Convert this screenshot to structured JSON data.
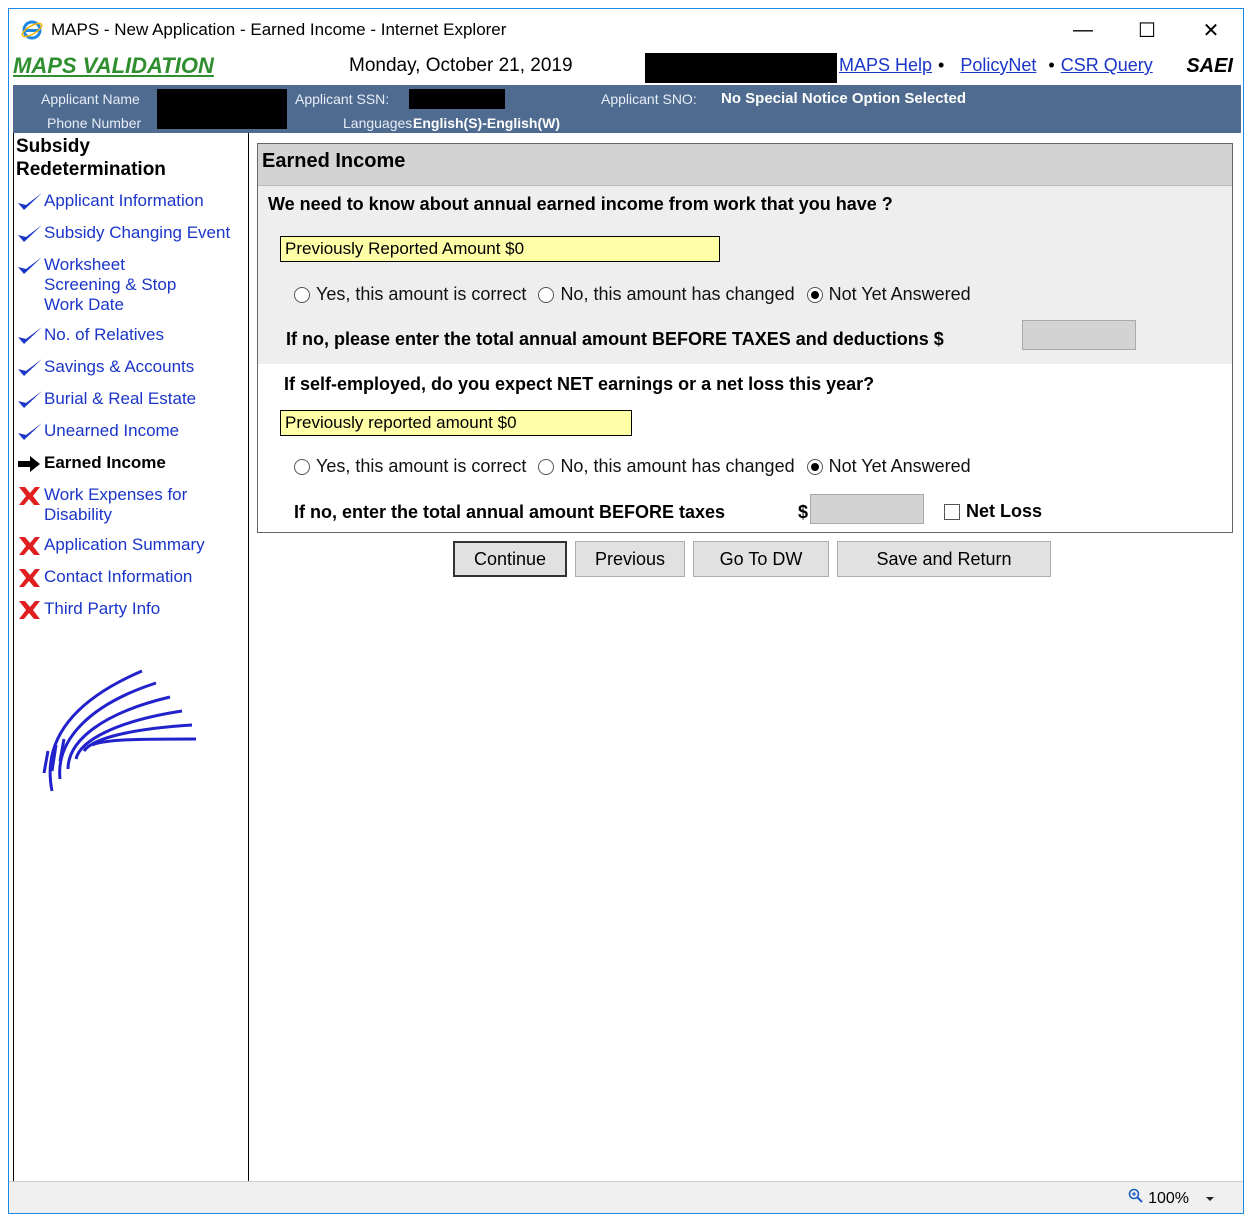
{
  "window": {
    "title": "MAPS - New Application - Earned Income - Internet Explorer",
    "minimize": "—",
    "maximize": "☐",
    "close": "✕"
  },
  "header": {
    "app_name": "MAPS VALIDATION",
    "date": "Monday, October 21, 2019",
    "links": [
      {
        "label": "MAPS Help"
      },
      {
        "label": "PolicyNet"
      },
      {
        "label": "CSR Query"
      }
    ],
    "separator": "•",
    "system_code": "SAEI"
  },
  "applicant": {
    "name_label": "Applicant Name",
    "phone_label": "Phone Number",
    "ssn_label": "Applicant SSN:",
    "languages_label": "Languages:",
    "languages_value": "English(S)-English(W)",
    "sno_label": "Applicant SNO:",
    "sno_value": "No Special Notice Option Selected"
  },
  "nav": {
    "title": "Subsidy Redetermination",
    "items": [
      {
        "label": "Applicant Information",
        "status": "check"
      },
      {
        "label": "Subsidy Changing Event",
        "status": "check"
      },
      {
        "label": "Worksheet Screening  & Stop Work  Date",
        "status": "check"
      },
      {
        "label": "No. of Relatives",
        "status": "check"
      },
      {
        "label": "Savings & Accounts",
        "status": "check"
      },
      {
        "label": "Burial & Real Estate",
        "status": "check"
      },
      {
        "label": "Unearned Income",
        "status": "check"
      },
      {
        "label": "Earned Income",
        "status": "current"
      },
      {
        "label": "Work Expenses for Disability",
        "status": "x"
      },
      {
        "label": "Application Summary",
        "status": "x"
      },
      {
        "label": "Contact Information",
        "status": "x"
      },
      {
        "label": "Third Party Info",
        "status": "x"
      }
    ]
  },
  "form": {
    "title": "Earned Income",
    "q1": {
      "question": "We need to know about annual earned income from work that you have ?",
      "previous": "Previously Reported Amount $0",
      "options": [
        "Yes, this amount is correct",
        "No, this amount has changed",
        "Not Yet Answered"
      ],
      "selected": 2,
      "amount_label": "If no, please enter the total annual amount BEFORE TAXES and deductions $",
      "amount_value": ""
    },
    "q2": {
      "question": "If self-employed, do you expect NET earnings or a net loss this year?",
      "previous": "Previously reported amount $0",
      "options": [
        "Yes, this amount is correct",
        "No, this amount has changed",
        "Not Yet Answered"
      ],
      "selected": 2,
      "amount_label": "If no, enter the total annual amount BEFORE taxes",
      "dollar": "$",
      "amount_value": "",
      "net_loss_label": "Net Loss"
    }
  },
  "buttons": {
    "continue": "Continue",
    "previous": "Previous",
    "go_to_dw": "Go To DW",
    "save_return": "Save and Return"
  },
  "status": {
    "zoom": "100%"
  },
  "colors": {
    "link": "#1a35c8",
    "brand_green": "#2f8f2f",
    "applicant_bar": "#4f6b8f",
    "highlight": "#ffffa8"
  }
}
